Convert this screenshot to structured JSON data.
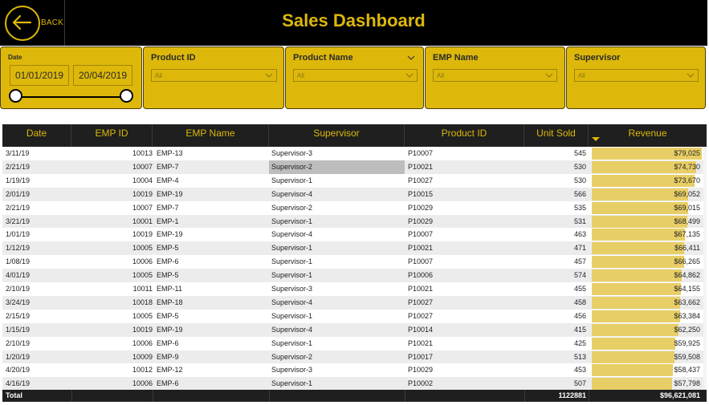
{
  "header": {
    "title": "Sales Dashboard",
    "back_label": "BACK"
  },
  "filters": {
    "date": {
      "label": "Date",
      "start": "01/01/2019",
      "end": "20/04/2019"
    },
    "product_id": {
      "label": "Product ID",
      "value": "All"
    },
    "product_name": {
      "label": "Product Name",
      "value": "All"
    },
    "emp_name": {
      "label": "EMP Name",
      "value": "All"
    },
    "supervisor": {
      "label": "Supervisor",
      "value": "All"
    }
  },
  "table": {
    "columns": [
      "Date",
      "EMP ID",
      "EMP Name",
      "Supervisor",
      "Product ID",
      "Unit Sold",
      "Revenue"
    ],
    "sorted_column": "Revenue",
    "max_revenue": 79025,
    "highlight_color": "#E8CE66",
    "rows": [
      {
        "date": "3/11/19",
        "emp_id": "10013",
        "emp_name": "EMP-13",
        "supervisor": "Supervisor-3",
        "product_id": "P10007",
        "unit_sold": "545",
        "revenue": "$79,025",
        "revenue_value": 79025
      },
      {
        "date": "2/21/19",
        "emp_id": "10007",
        "emp_name": "EMP-7",
        "supervisor": "Supervisor-2",
        "product_id": "P10021",
        "unit_sold": "530",
        "revenue": "$74,730",
        "revenue_value": 74730,
        "selected": true
      },
      {
        "date": "1/19/19",
        "emp_id": "10004",
        "emp_name": "EMP-4",
        "supervisor": "Supervisor-1",
        "product_id": "P10027",
        "unit_sold": "530",
        "revenue": "$73,670",
        "revenue_value": 73670
      },
      {
        "date": "2/01/19",
        "emp_id": "10019",
        "emp_name": "EMP-19",
        "supervisor": "Supervisor-4",
        "product_id": "P10015",
        "unit_sold": "566",
        "revenue": "$69,052",
        "revenue_value": 69052
      },
      {
        "date": "2/21/19",
        "emp_id": "10007",
        "emp_name": "EMP-7",
        "supervisor": "Supervisor-2",
        "product_id": "P10029",
        "unit_sold": "535",
        "revenue": "$69,015",
        "revenue_value": 69015
      },
      {
        "date": "3/21/19",
        "emp_id": "10001",
        "emp_name": "EMP-1",
        "supervisor": "Supervisor-1",
        "product_id": "P10029",
        "unit_sold": "531",
        "revenue": "$68,499",
        "revenue_value": 68499
      },
      {
        "date": "1/01/19",
        "emp_id": "10019",
        "emp_name": "EMP-19",
        "supervisor": "Supervisor-4",
        "product_id": "P10007",
        "unit_sold": "463",
        "revenue": "$67,135",
        "revenue_value": 67135
      },
      {
        "date": "1/12/19",
        "emp_id": "10005",
        "emp_name": "EMP-5",
        "supervisor": "Supervisor-1",
        "product_id": "P10021",
        "unit_sold": "471",
        "revenue": "$66,411",
        "revenue_value": 66411
      },
      {
        "date": "1/08/19",
        "emp_id": "10006",
        "emp_name": "EMP-6",
        "supervisor": "Supervisor-1",
        "product_id": "P10007",
        "unit_sold": "457",
        "revenue": "$66,265",
        "revenue_value": 66265
      },
      {
        "date": "4/01/19",
        "emp_id": "10005",
        "emp_name": "EMP-5",
        "supervisor": "Supervisor-1",
        "product_id": "P10006",
        "unit_sold": "574",
        "revenue": "$64,862",
        "revenue_value": 64862
      },
      {
        "date": "2/10/19",
        "emp_id": "10011",
        "emp_name": "EMP-11",
        "supervisor": "Supervisor-3",
        "product_id": "P10021",
        "unit_sold": "455",
        "revenue": "$64,155",
        "revenue_value": 64155
      },
      {
        "date": "3/24/19",
        "emp_id": "10018",
        "emp_name": "EMP-18",
        "supervisor": "Supervisor-4",
        "product_id": "P10027",
        "unit_sold": "458",
        "revenue": "$63,662",
        "revenue_value": 63662
      },
      {
        "date": "2/15/19",
        "emp_id": "10005",
        "emp_name": "EMP-5",
        "supervisor": "Supervisor-1",
        "product_id": "P10027",
        "unit_sold": "456",
        "revenue": "$63,384",
        "revenue_value": 63384
      },
      {
        "date": "1/15/19",
        "emp_id": "10019",
        "emp_name": "EMP-19",
        "supervisor": "Supervisor-4",
        "product_id": "P10014",
        "unit_sold": "415",
        "revenue": "$62,250",
        "revenue_value": 62250
      },
      {
        "date": "2/10/19",
        "emp_id": "10006",
        "emp_name": "EMP-6",
        "supervisor": "Supervisor-1",
        "product_id": "P10021",
        "unit_sold": "425",
        "revenue": "$59,925",
        "revenue_value": 59925
      },
      {
        "date": "1/20/19",
        "emp_id": "10009",
        "emp_name": "EMP-9",
        "supervisor": "Supervisor-2",
        "product_id": "P10017",
        "unit_sold": "513",
        "revenue": "$59,508",
        "revenue_value": 59508
      },
      {
        "date": "4/20/19",
        "emp_id": "10012",
        "emp_name": "EMP-12",
        "supervisor": "Supervisor-3",
        "product_id": "P10029",
        "unit_sold": "453",
        "revenue": "$58,437",
        "revenue_value": 58437
      },
      {
        "date": "4/16/19",
        "emp_id": "10006",
        "emp_name": "EMP-6",
        "supervisor": "Supervisor-1",
        "product_id": "P10002",
        "unit_sold": "507",
        "revenue": "$57,798",
        "revenue_value": 57798
      }
    ],
    "total": {
      "label": "Total",
      "unit_sold": "1122881",
      "revenue": "$96,621,081"
    }
  }
}
